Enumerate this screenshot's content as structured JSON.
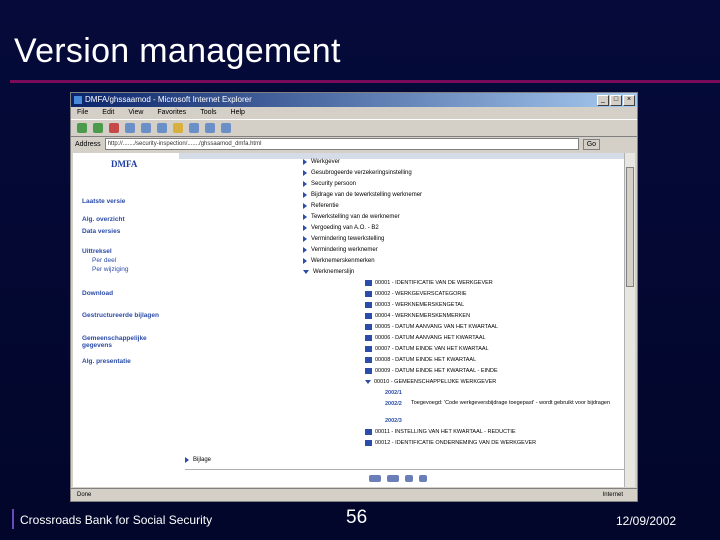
{
  "slide": {
    "title": "Version management",
    "footer_left": "Crossroads Bank for Social Security",
    "page_number": "56",
    "date": "12/09/2002"
  },
  "browser": {
    "window_title": "DMFA/ghssaamod - Microsoft Internet Explorer",
    "menu": [
      "File",
      "Edit",
      "View",
      "Favorites",
      "Tools",
      "Help"
    ],
    "address_label": "Address",
    "address_value": "http://......./security-inspection/......./ghssaamod_dmfa.html",
    "go_label": "Go",
    "status_text": "Done",
    "status_zone": "Internet"
  },
  "left_nav": {
    "logo": "DMFA",
    "links": [
      "Laatste versie",
      "Alg. overzicht",
      "Data versies",
      "Uittreksel",
      "Download",
      "Gestructureerde bijlagen",
      "Gemeenschappelijke gegevens",
      "Alg. presentatie"
    ],
    "sublinks": [
      "Per deel",
      "Per wijziging"
    ]
  },
  "main_items": [
    "Werkgever",
    "Gesubrogeerde verzekeringsinstelling",
    "Security persoon",
    "Bijdrage van de tewerkstelling werknemer",
    "Referentie",
    "Tewerkstelling van de werknemer",
    "Vergoeding van A.O. - B2",
    "Vermindering tewerkstelling",
    "Vermindering werknemer",
    "Werknemerskenmerken",
    "Werknemerslijn"
  ],
  "sub_items": [
    "00001 - IDENTIFICATIE VAN DE WERKGEVER",
    "00002 - WERKGEVERSCATEGORIE",
    "00003 - WERKNEMERSKENGETAL",
    "00004 - WERKNEMERSKENMERKEN",
    "00005 - DATUM AANVANG VAN HET KWARTAAL",
    "00006 - DATUM AANVANG HET KWARTAAL",
    "00007 - DATUM EINDE VAN HET KWARTAAL",
    "00008 - DATUM EINDE HET KWARTAAL",
    "00009 - DATUM EINDE HET KWARTAAL - EINDE"
  ],
  "expanded_item": "00010 - GEMEENSCHAPPELIJKE WERKGEVER",
  "versions": [
    {
      "label": "2002/1",
      "text": ""
    },
    {
      "label": "2002/2",
      "text": "Toegevoegd: 'Code werkgeversbijdrage toegepast' - wordt gebruikt voor bijdragen"
    },
    {
      "label": "2002/3",
      "text": ""
    }
  ],
  "after_items": [
    "00011 - INSTELLING VAN HET KWARTAAL - REDUCTIE",
    "00012 - IDENTIFICATIE ONDERNEMING VAN DE WERKGEVER"
  ],
  "bijlage": "Bijlage"
}
